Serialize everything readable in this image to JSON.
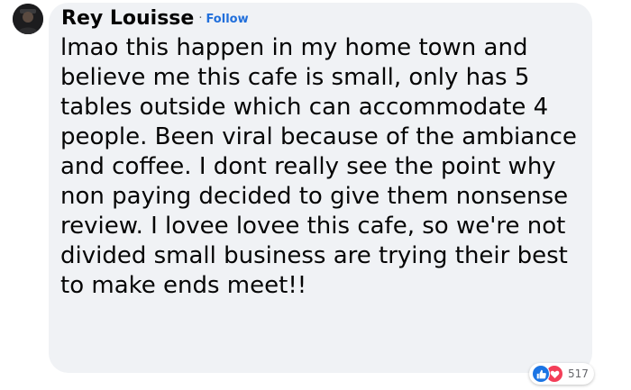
{
  "comment": {
    "author": "Rey Louisse",
    "separator": "·",
    "follow_label": "Follow",
    "text": "lmao this happen in my home town and believe me this cafe is small, only has 5 tables outside which can accommodate 4 people. Been viral because of the ambiance and coffee. I dont really see the point why non paying decided to give them nonsense review. I lovee lovee this cafe, so we're not divided small business are trying their best to make ends meet!!",
    "reactions": {
      "icons": [
        "like-icon",
        "love-icon"
      ],
      "count": "517"
    }
  },
  "colors": {
    "bubble": "#f0f2f5",
    "follow": "#216fdb",
    "like": "#1b74e4",
    "love": "#f33e58"
  }
}
